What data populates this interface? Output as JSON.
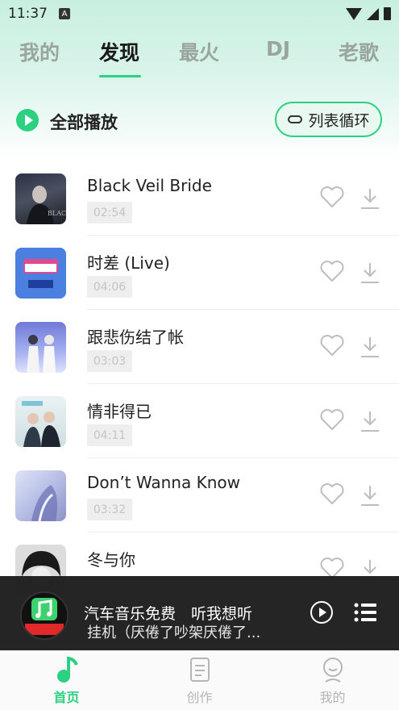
{
  "status_bar": {
    "time": "11:37",
    "notification_icon": "A"
  },
  "tabs": [
    {
      "label": "我的"
    },
    {
      "label": "发现"
    },
    {
      "label": "最火"
    },
    {
      "label": "DJ"
    },
    {
      "label": "老歌"
    }
  ],
  "play_all": {
    "label": "全部播放",
    "loop_mode": "列表循环"
  },
  "songs": [
    {
      "title": "Black Veil Bride",
      "duration": "02:54"
    },
    {
      "title": "时差 (Live)",
      "duration": "04:06"
    },
    {
      "title": "跟悲伤结了帐",
      "duration": "03:03"
    },
    {
      "title": "情非得已",
      "duration": "04:11"
    },
    {
      "title": "Don’t Wanna Know",
      "duration": "03:32"
    },
    {
      "title": "冬与你",
      "duration": ""
    }
  ],
  "obscured_song_title": "挂机（厌倦了吵架厌倦了...",
  "mini_player": {
    "title": "汽车音乐免费　听我想听"
  },
  "bottom_nav": [
    {
      "label": "首页"
    },
    {
      "label": "创作"
    },
    {
      "label": "我的"
    }
  ],
  "colors": {
    "accent": "#2bd180",
    "player_bg": "#1c1c1c"
  },
  "icons": {
    "play_all": "play-circle-icon",
    "loop": "loop-icon",
    "like": "heart-icon",
    "download": "download-icon",
    "mini_play": "play-outline-icon",
    "playlist": "playlist-icon",
    "home": "music-note-icon",
    "create": "document-icon",
    "profile": "person-icon"
  }
}
